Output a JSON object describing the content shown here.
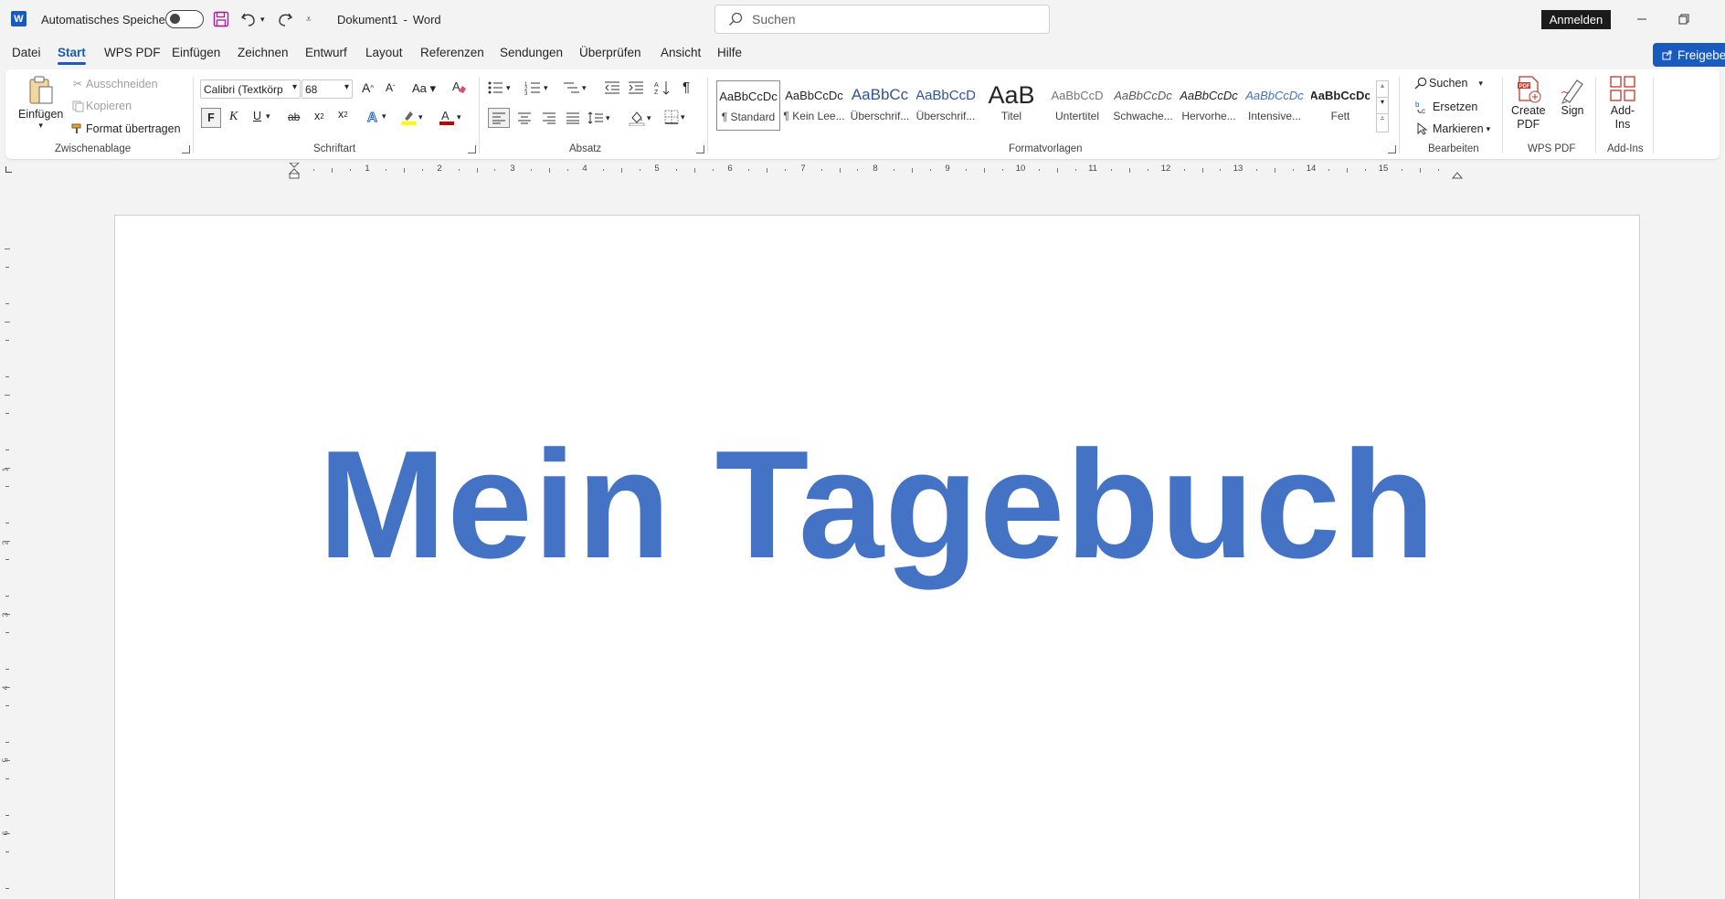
{
  "titlebar": {
    "autosave_label": "Automatisches Speichern",
    "doc_title": "Dokument1",
    "sep": "-",
    "app_name": "Word",
    "search_placeholder": "Suchen",
    "signin_label": "Anmelden"
  },
  "menu": {
    "tabs": [
      "Datei",
      "Start",
      "WPS PDF",
      "Einfügen",
      "Zeichnen",
      "Entwurf",
      "Layout",
      "Referenzen",
      "Sendungen",
      "Überprüfen",
      "Ansicht",
      "Hilfe"
    ],
    "active": "Start",
    "share_label": "Freigeben"
  },
  "ribbon": {
    "clipboard": {
      "paste": "Einfügen",
      "cut": "Ausschneiden",
      "copy": "Kopieren",
      "format_painter": "Format übertragen",
      "group": "Zwischenablage"
    },
    "font": {
      "font_name": "Calibri (Textkörp",
      "font_size": "68",
      "bold": "F",
      "italic": "K",
      "underline": "U",
      "strike": "ab",
      "group": "Schriftart"
    },
    "paragraph": {
      "group": "Absatz"
    },
    "styles": {
      "items": [
        {
          "preview": "AaBbCcDc",
          "name": "¶ Standard"
        },
        {
          "preview": "AaBbCcDc",
          "name": "¶ Kein Lee..."
        },
        {
          "preview": "AaBbCc",
          "name": "Überschrif..."
        },
        {
          "preview": "AaBbCcD",
          "name": "Überschrif..."
        },
        {
          "preview": "AaB",
          "name": "Titel"
        },
        {
          "preview": "AaBbCcD",
          "name": "Untertitel"
        },
        {
          "preview": "AaBbCcDc",
          "name": "Schwache..."
        },
        {
          "preview": "AaBbCcDc",
          "name": "Hervorhe..."
        },
        {
          "preview": "AaBbCcDc",
          "name": "Intensive..."
        },
        {
          "preview": "AaBbCcDc",
          "name": "Fett"
        }
      ],
      "group": "Formatvorlagen"
    },
    "editing": {
      "find": "Suchen",
      "replace": "Ersetzen",
      "select": "Markieren",
      "group": "Bearbeiten"
    },
    "wps": {
      "create_line1": "Create",
      "create_line2": "PDF",
      "sign": "Sign",
      "group": "WPS PDF"
    },
    "addins": {
      "line1": "Add-",
      "line2": "Ins",
      "group": "Add-Ins"
    }
  },
  "ruler": {
    "numbers": [
      "1",
      "2",
      "3",
      "4",
      "5",
      "6",
      "7",
      "8",
      "9",
      "10",
      "11",
      "12",
      "13",
      "14",
      "15"
    ],
    "vnumbers": [
      "1",
      "2",
      "3",
      "4",
      "5",
      "6"
    ]
  },
  "document": {
    "text": "Mein Tagebuch",
    "color": "#4472c4"
  },
  "colors": {
    "accent": "#185abd",
    "highlight": "#ffff00",
    "font_color": "#c00000"
  }
}
